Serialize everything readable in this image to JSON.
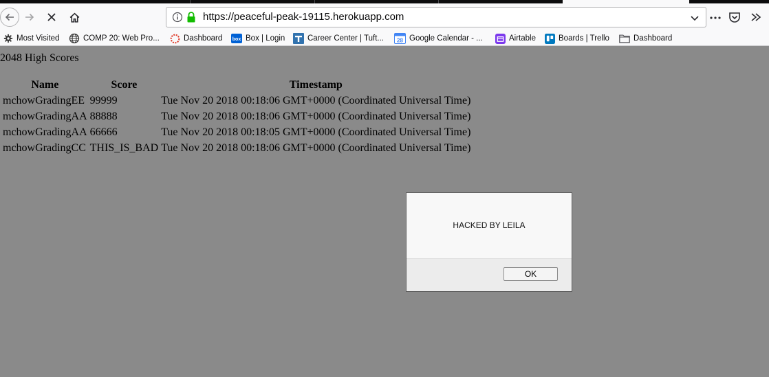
{
  "browser": {
    "url": "https://peaceful-peak-19115.herokuapp.com",
    "toolbar_icons": [
      "back-arrow-icon",
      "forward-arrow-icon",
      "stop-icon",
      "home-icon",
      "info-icon",
      "lock-icon",
      "chevron-down-icon",
      "more-icon",
      "pocket-icon",
      "overflow-icon"
    ],
    "bookmarks": [
      {
        "label": "Most Visited",
        "icon": "gear-icon"
      },
      {
        "label": "COMP 20: Web Pro...",
        "icon": "globe-icon"
      },
      {
        "label": "Dashboard",
        "icon": "dashboard-icon"
      },
      {
        "label": "Box | Login",
        "icon": "box-icon"
      },
      {
        "label": "Career Center | Tuft...",
        "icon": "tufts-icon"
      },
      {
        "label": "Google Calendar - ...",
        "icon": "calendar-icon"
      },
      {
        "label": "Airtable",
        "icon": "airtable-icon"
      },
      {
        "label": "Boards | Trello",
        "icon": "trello-icon"
      },
      {
        "label": "Dashboard",
        "icon": "folder-icon"
      }
    ],
    "calendar_icon_text": "28"
  },
  "page": {
    "heading": "2048 High Scores",
    "columns": [
      "Name",
      "Score",
      "Timestamp"
    ],
    "rows": [
      [
        "mchowGradingEE",
        "99999",
        "Tue Nov 20 2018 00:18:06 GMT+0000 (Coordinated Universal Time)"
      ],
      [
        "mchowGradingAA",
        "88888",
        "Tue Nov 20 2018 00:18:06 GMT+0000 (Coordinated Universal Time)"
      ],
      [
        "mchowGradingAA",
        "66666",
        "Tue Nov 20 2018 00:18:05 GMT+0000 (Coordinated Universal Time)"
      ],
      [
        "mchowGradingCC",
        "THIS_IS_BAD",
        "Tue Nov 20 2018 00:18:06 GMT+0000 (Coordinated Universal Time)"
      ]
    ]
  },
  "alert": {
    "message": "HACKED BY LEILA",
    "ok_label": "OK"
  },
  "colors": {
    "overlay_bg": "#8a8a8a",
    "lock_green": "#12bc00",
    "box_blue": "#0061d5",
    "trello_blue": "#0079bf",
    "airtable_purple": "#7c39ed"
  }
}
